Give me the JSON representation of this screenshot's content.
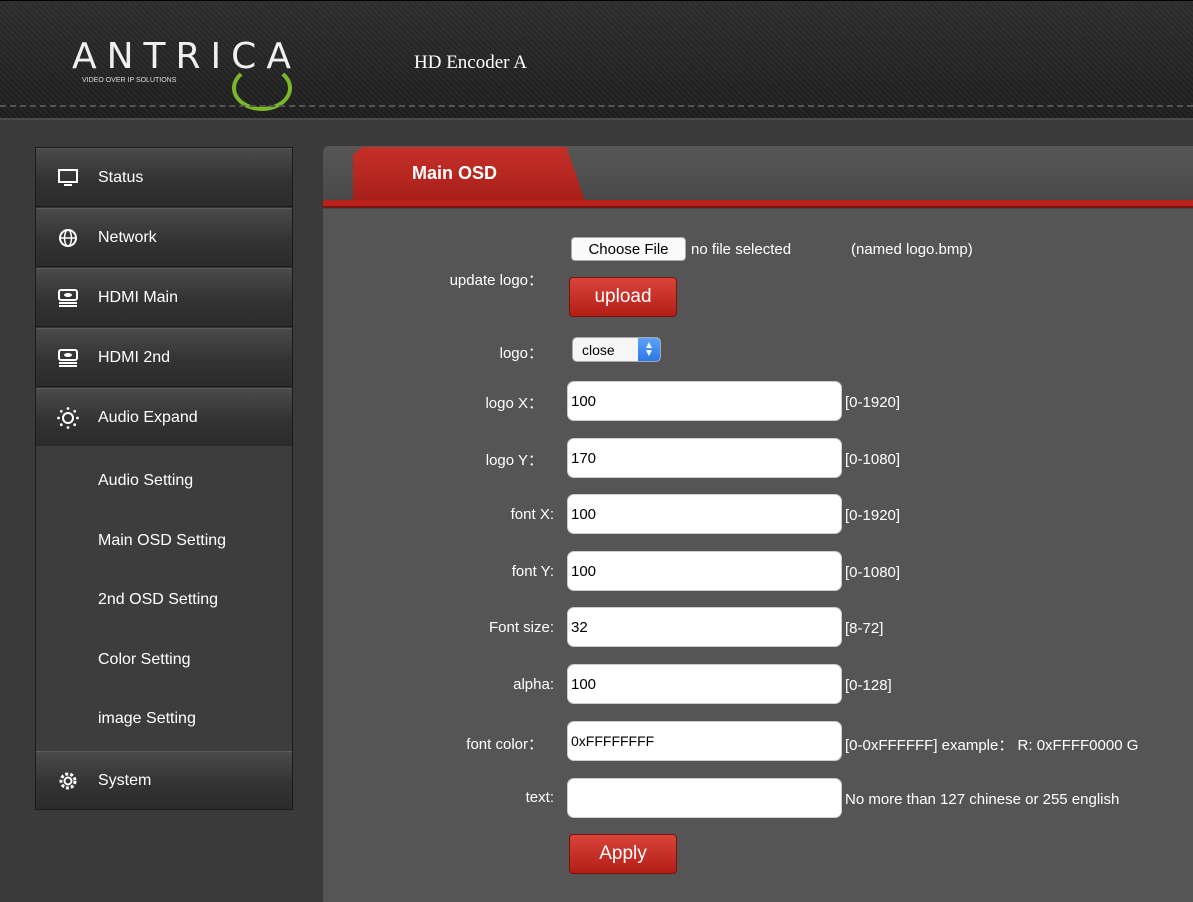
{
  "header": {
    "brand": "ANTRICA",
    "tagline": "VIDEO OVER IP SOLUTIONS",
    "title": "HD Encoder  A"
  },
  "sidebar": {
    "items": [
      {
        "label": "Status",
        "icon": "monitor-icon"
      },
      {
        "label": "Network",
        "icon": "globe-icon"
      },
      {
        "label": "HDMI Main",
        "icon": "hdmi-device-icon"
      },
      {
        "label": "HDMI 2nd",
        "icon": "hdmi-device-icon"
      },
      {
        "label": "Audio Expand",
        "icon": "sun-gear-icon"
      },
      {
        "label": "System",
        "icon": "gear-icon"
      }
    ],
    "subitems": [
      {
        "label": "Audio Setting"
      },
      {
        "label": "Main OSD Setting"
      },
      {
        "label": "2nd OSD Setting"
      },
      {
        "label": "Color Setting"
      },
      {
        "label": "image Setting"
      }
    ]
  },
  "main": {
    "tab": "Main OSD",
    "update_logo": {
      "label": "update logo：",
      "choose_file": "Choose File",
      "no_file": "no file selected",
      "note": "(named logo.bmp)",
      "upload": "upload"
    },
    "logo": {
      "label": "logo：",
      "value": "close"
    },
    "fields": [
      {
        "label": "logo X：",
        "value": "100",
        "hint": "[0-1920]"
      },
      {
        "label": "logo Y：",
        "value": "170",
        "hint": "[0-1080]"
      },
      {
        "label": "font X:",
        "value": "100",
        "hint": "[0-1920]"
      },
      {
        "label": "font Y:",
        "value": "100",
        "hint": "[0-1080]"
      },
      {
        "label": "Font size:",
        "value": "32",
        "hint": "[8-72]"
      },
      {
        "label": "alpha:",
        "value": "100",
        "hint": "[0-128]"
      },
      {
        "label": "font color：",
        "value": "0xFFFFFFFF",
        "hint": "[0-0xFFFFFF] example： R: 0xFFFF0000 G"
      },
      {
        "label": "text:",
        "value": "",
        "hint": "No more than 127 chinese or 255 english"
      }
    ],
    "apply": "Apply"
  },
  "colors": {
    "accent_red": "#b9221c",
    "panel_bg": "#555555",
    "logo_ring": "#7ab82a"
  }
}
